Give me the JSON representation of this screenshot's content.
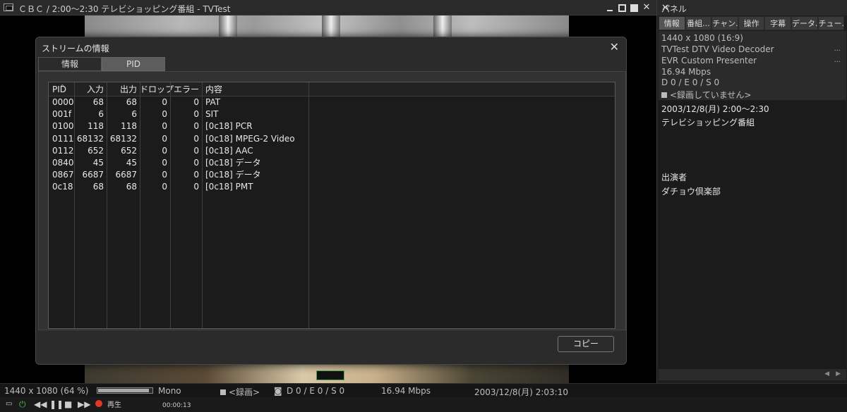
{
  "main_window": {
    "title": "ＣＢＣ / 2:00〜2:30 テレビショッピング番組 - TVTest"
  },
  "dialog": {
    "title": "ストリームの情報",
    "tabs": [
      {
        "label": "情報"
      },
      {
        "label": "PID"
      }
    ],
    "active_tab": "PID",
    "columns": [
      "PID",
      "入力",
      "出力",
      "ドロップ",
      "エラー",
      "内容"
    ],
    "rows": [
      {
        "pid": "0000",
        "in": "68",
        "out": "68",
        "drop": "0",
        "err": "0",
        "desc": "PAT"
      },
      {
        "pid": "001f",
        "in": "6",
        "out": "6",
        "drop": "0",
        "err": "0",
        "desc": "SIT"
      },
      {
        "pid": "0100",
        "in": "118",
        "out": "118",
        "drop": "0",
        "err": "0",
        "desc": "[0c18] PCR"
      },
      {
        "pid": "0111",
        "in": "68132",
        "out": "68132",
        "drop": "0",
        "err": "0",
        "desc": "[0c18] MPEG-2 Video"
      },
      {
        "pid": "0112",
        "in": "652",
        "out": "652",
        "drop": "0",
        "err": "0",
        "desc": "[0c18] AAC"
      },
      {
        "pid": "0840",
        "in": "45",
        "out": "45",
        "drop": "0",
        "err": "0",
        "desc": "[0c18] データ"
      },
      {
        "pid": "0867",
        "in": "6687",
        "out": "6687",
        "drop": "0",
        "err": "0",
        "desc": "[0c18] データ"
      },
      {
        "pid": "0c18",
        "in": "68",
        "out": "68",
        "drop": "0",
        "err": "0",
        "desc": "[0c18] PMT"
      }
    ],
    "copy_label": "コピー",
    "close_glyph": "✕"
  },
  "panel": {
    "title": "パネル",
    "tabs": [
      "情報",
      "番組...",
      "チャン...",
      "操作",
      "字幕",
      "データ...",
      "チュー..."
    ],
    "info": {
      "resolution": "1440 x 1080 (16:9)",
      "decoder": "TVTest DTV Video Decoder",
      "renderer": "EVR Custom Presenter",
      "bitrate": "16.94 Mbps",
      "errors": "D 0 / E 0 / S 0",
      "rec_status": "<録画していません>",
      "more": "..."
    },
    "epg": {
      "time": "2003/12/8(月) 2:00〜2:30",
      "program": "テレビショッピング番組",
      "cast_label": "出演者",
      "cast": "ダチョウ倶楽部"
    }
  },
  "status_bar": {
    "video": "1440 x 1080 (64 %)",
    "volume_level": 0.95,
    "audio": "Mono",
    "record": "<録画>",
    "errors": "D 0 / E 0 / S 0",
    "bitrate": "16.94 Mbps",
    "clock": "2003/12/8(月) 2:03:10"
  },
  "controls": {
    "play_status": "再生",
    "elapsed": "00:00:13"
  },
  "colors": {
    "record_dot": "#e23a22",
    "power": "#3ec63e",
    "active_tab": "#5d5d5d"
  }
}
